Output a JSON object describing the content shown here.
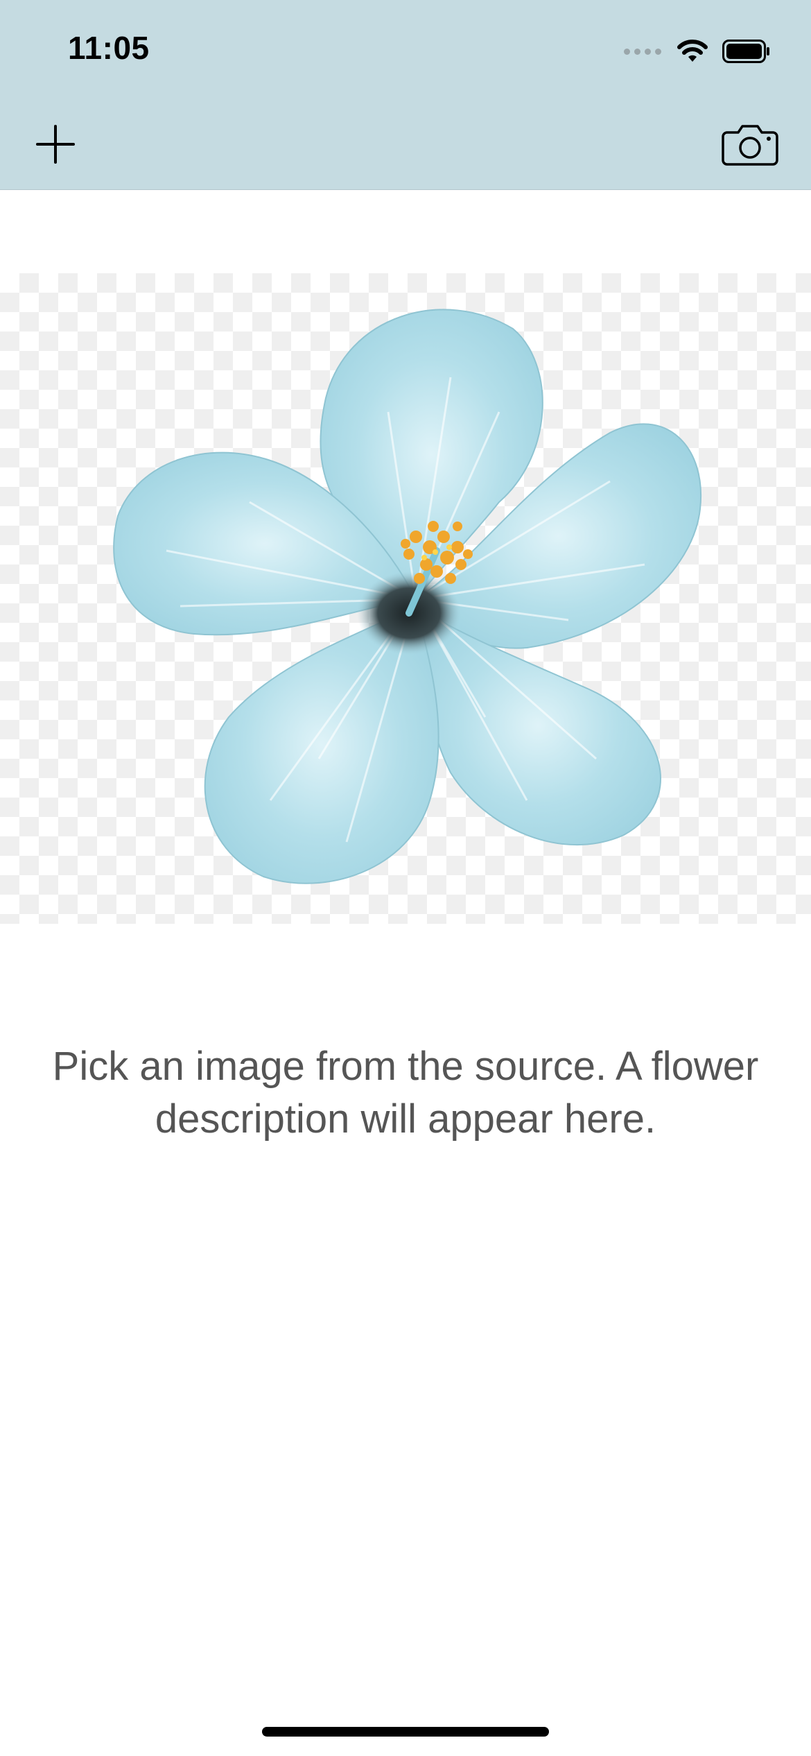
{
  "status_bar": {
    "time": "11:05"
  },
  "nav": {
    "left_icon": "plus-icon",
    "right_icon": "camera-icon"
  },
  "image": {
    "icon": "hibiscus-flower-image"
  },
  "description": {
    "text": "Pick an image from the source. A flower description will appear here."
  },
  "colors": {
    "nav_background": "#c5dbe1",
    "description_text": "#555555",
    "petal": "#b6e0ea"
  }
}
